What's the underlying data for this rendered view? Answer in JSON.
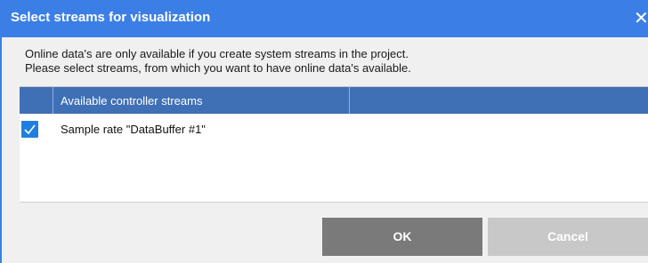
{
  "window": {
    "title": "Select streams for visualization",
    "close_glyph": "✕"
  },
  "info": {
    "line1": "Online data's are only available if you create system streams in the project.",
    "line2": "Please select streams, from which you want to have online data's available."
  },
  "grid": {
    "header": {
      "check_column": "",
      "name_column": "Available controller streams"
    },
    "rows": [
      {
        "checked": true,
        "label": "Sample rate \"DataBuffer #1\""
      }
    ]
  },
  "buttons": {
    "ok_label": "OK",
    "cancel_label": "Cancel"
  },
  "colors": {
    "titlebar": "#3b7fe6",
    "grid_header": "#3f6fb5",
    "checkbox": "#1f7fe0",
    "ok_button": "#7a7a7a",
    "cancel_button": "#c8c8c8"
  },
  "icons": {
    "close": "close-icon",
    "checkbox": "checkmark-icon"
  }
}
